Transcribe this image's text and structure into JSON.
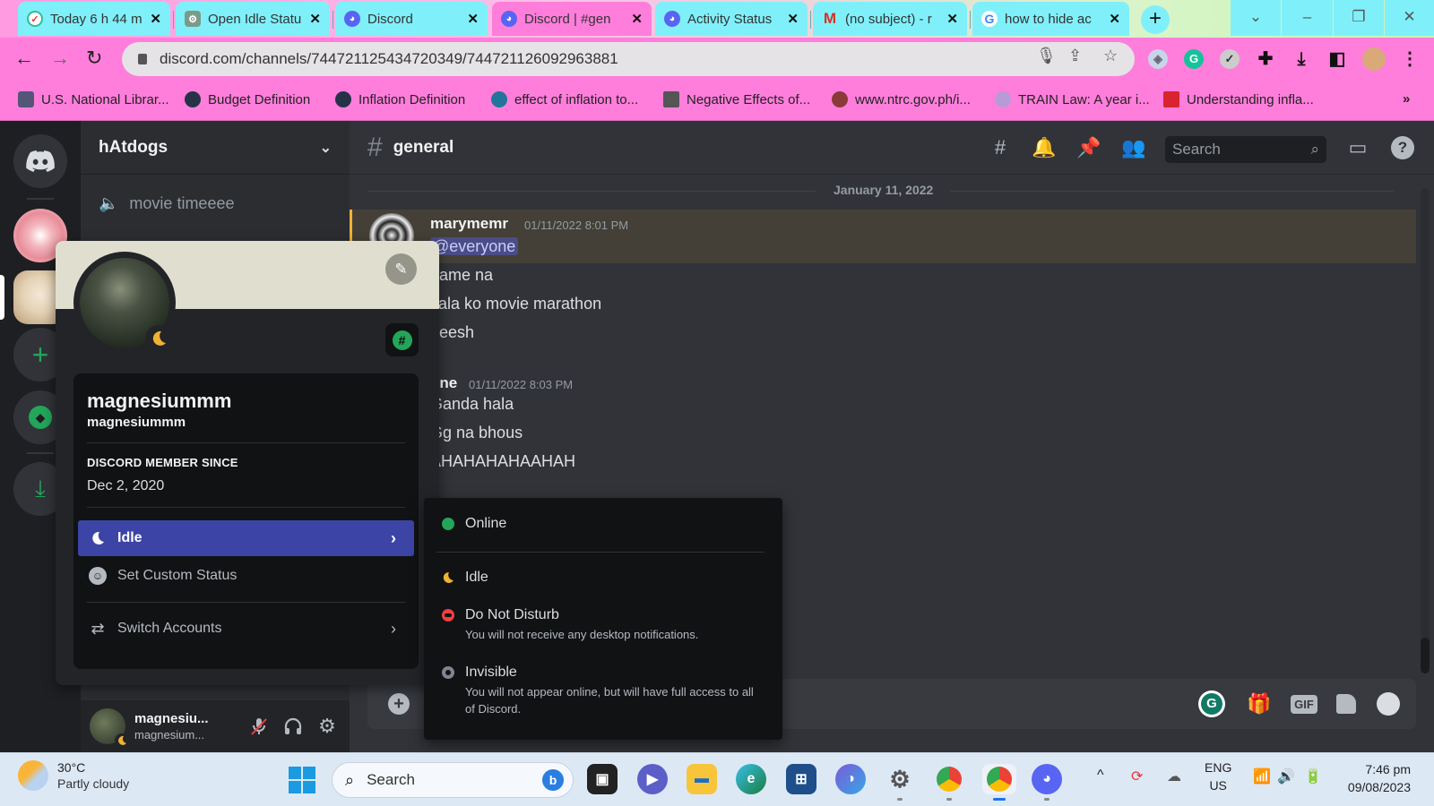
{
  "browser": {
    "tabs": [
      {
        "title": "Today 6 h 44 m",
        "icon": "timer-icon",
        "active": false
      },
      {
        "title": "Open Idle Statu",
        "icon": "chatgpt-icon",
        "active": false
      },
      {
        "title": "Discord",
        "icon": "discord-icon",
        "active": false
      },
      {
        "title": "Discord | #gen",
        "icon": "discord-icon",
        "active": true
      },
      {
        "title": "Activity Status",
        "icon": "discord-icon",
        "active": false
      },
      {
        "title": "(no subject) - r",
        "icon": "gmail-icon",
        "active": false
      },
      {
        "title": "how to hide ac",
        "icon": "google-icon",
        "active": false
      }
    ],
    "close_glyph": "✕",
    "new_tab_glyph": "+",
    "window_controls": {
      "tab_search": "⌄",
      "minimize": "–",
      "restore": "❐",
      "close": "✕"
    },
    "url": "discord.com/channels/744721125434720349/744721126092963881",
    "bookmarks": [
      {
        "label": "U.S. National Librar...",
        "color": "#555577"
      },
      {
        "label": "Budget Definition",
        "color": "#263248"
      },
      {
        "label": "Inflation Definition",
        "color": "#263248"
      },
      {
        "label": "effect of inflation to...",
        "color": "#21759b"
      },
      {
        "label": "Negative Effects of...",
        "color": "#555555"
      },
      {
        "label": "www.ntrc.gov.ph/i...",
        "color": "#8b3a3a"
      },
      {
        "label": "TRAIN Law: A year i...",
        "color": "#b79ad8"
      },
      {
        "label": "Understanding infla...",
        "color": "#d9232e"
      }
    ],
    "bookmarks_overflow": "»"
  },
  "discord": {
    "server_name": "hAtdogs",
    "voice_channel": "movie timeeee",
    "channel_name": "general",
    "search_placeholder": "Search",
    "date_divider": "January 11, 2022",
    "messages": [
      {
        "author": "marymemr",
        "timestamp": "01/11/2022 8:01 PM",
        "mention": "@everyone",
        "lines": [
          "game na",
          "kala ko movie marathon",
          "heesh"
        ]
      },
      {
        "author": "nne",
        "timestamp": "01/11/2022 8:03 PM",
        "lines": [
          "Ganda hala",
          "Gg na bhous",
          "AHAHAHAHAAHAH"
        ]
      }
    ],
    "user_panel": {
      "display_name": "magnesiu...",
      "username": "magnesium..."
    },
    "profile": {
      "display_name": "magnesiummm",
      "username": "magnesiummm",
      "member_since_label": "DISCORD MEMBER SINCE",
      "member_since": "Dec 2, 2020",
      "current_status": "Idle",
      "custom_status_label": "Set Custom Status",
      "switch_accounts_label": "Switch Accounts",
      "badge_glyph": "#"
    },
    "status_menu": [
      {
        "label": "Online",
        "description": "",
        "color": "#23a55a"
      },
      {
        "label": "Idle",
        "description": "",
        "color": "#f0b232"
      },
      {
        "label": "Do Not Disturb",
        "description": "You will not receive any desktop notifications.",
        "color": "#f23f43"
      },
      {
        "label": "Invisible",
        "description": "You will not appear online, but will have full access to all of Discord.",
        "color": "#80848e"
      }
    ],
    "composer_icons": [
      "grammarly-icon",
      "gift-icon",
      "gif-icon",
      "sticker-icon",
      "emoji-icon"
    ],
    "gif_label": "GIF"
  },
  "taskbar": {
    "weather_temp": "30°C",
    "weather_desc": "Partly cloudy",
    "search_placeholder": "Search",
    "language": "ENG",
    "region": "US",
    "time": "7:46 pm",
    "date": "09/08/2023"
  }
}
